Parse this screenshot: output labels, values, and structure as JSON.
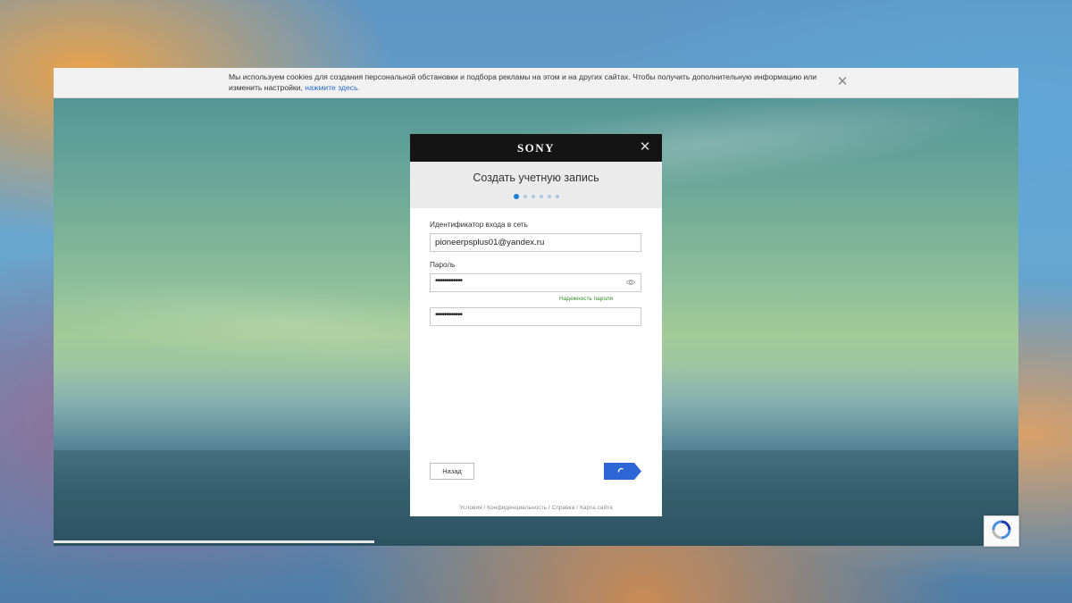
{
  "cookie_banner": {
    "text": "Мы используем cookies для создания персональной обстановки и подбора рекламы на этом и на других сайтах. Чтобы получить дополнительную информацию или изменить настройки, ",
    "link": "нажмите здесь.",
    "close_icon": "close-icon"
  },
  "modal": {
    "brand": "SONY",
    "title": "Создать учетную запись",
    "steps_total": 6,
    "steps_current": 1,
    "sign_in_id": {
      "label": "Идентификатор входа в сеть",
      "value": "pioneerpsplus01@yandex.ru"
    },
    "password": {
      "label": "Пароль",
      "masked_value": "••••••••••••",
      "confirm_masked_value": "••••••••••••",
      "strength_label": "Надежность пароля",
      "show_icon": "eye-icon"
    },
    "buttons": {
      "back": "Назад",
      "next_icon": "loading-spinner-icon"
    },
    "footer": {
      "terms": "Условия",
      "privacy": "Конфиденциальность",
      "help": "Справка",
      "sitemap": "Карта сайта",
      "separator": "/"
    }
  },
  "colors": {
    "accent": "#1f7fe0",
    "next_button": "#2e66d6",
    "strength": "#2d7a2a",
    "header": "#141414"
  },
  "recaptcha_icon": "recaptcha-icon"
}
